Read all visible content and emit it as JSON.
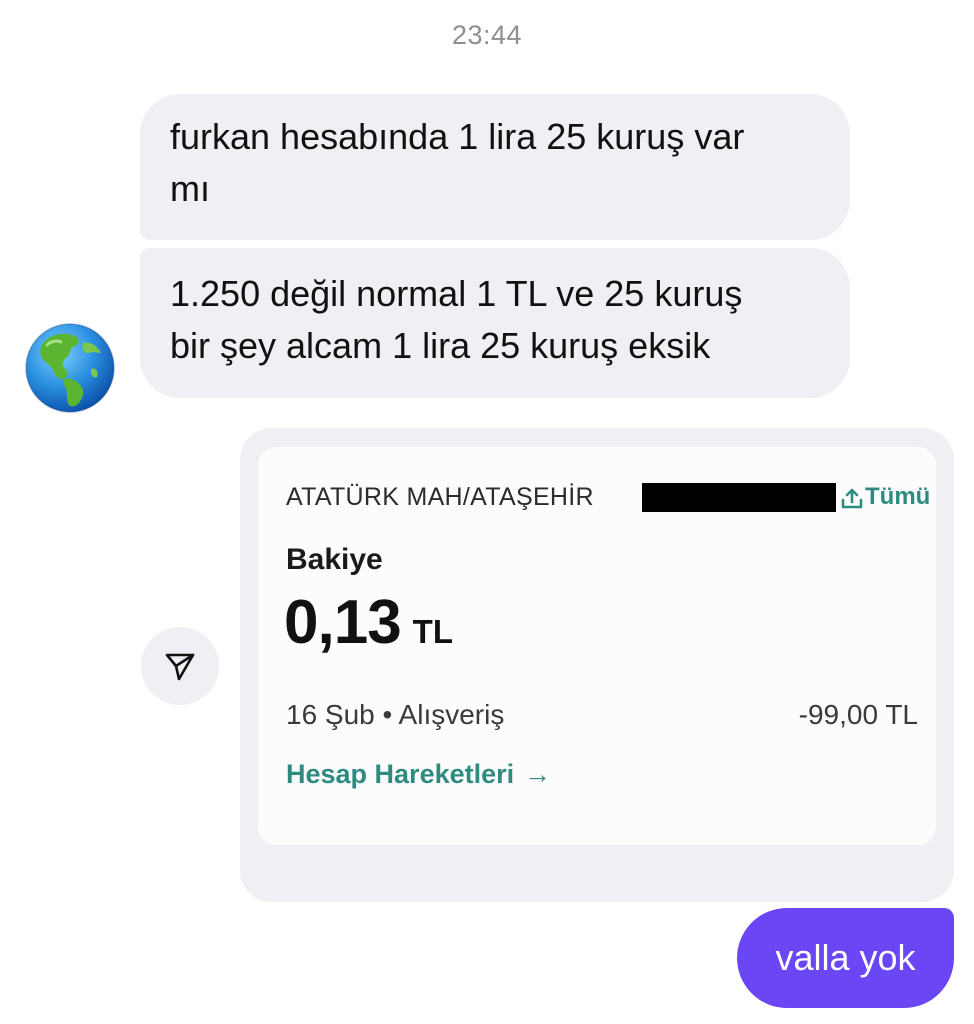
{
  "thread": {
    "timestamp": "23:44"
  },
  "messages": [
    {
      "direction": "incoming",
      "lines": [
        "furkan hesabında 1 lira 25 kuruş var",
        "mı"
      ]
    },
    {
      "direction": "incoming",
      "lines": [
        "1.250 değil normal 1 TL ve 25 kuruş",
        "bir şey alcam 1 lira 25 kuruş eksik"
      ]
    }
  ],
  "sender": {
    "avatar_icon": "globe-americas-icon"
  },
  "shared_card": {
    "address": "ATATÜRK MAH/ATAŞEHİR",
    "share_all_label": "Tümü",
    "share_icon": "share-up-icon",
    "balance_label": "Bakiye",
    "balance_amount": "0,13",
    "balance_currency": "TL",
    "transaction": {
      "description": "16 Şub • Alışveriş",
      "amount": "-99,00 TL"
    },
    "link_label": "Hesap Hareketleri",
    "link_arrow": "→",
    "accent_color": "#2f8b80"
  },
  "share_button": {
    "icon": "send-icon"
  },
  "reply": {
    "direction": "outgoing",
    "text": "valla yok",
    "color": "#6a46f5"
  }
}
